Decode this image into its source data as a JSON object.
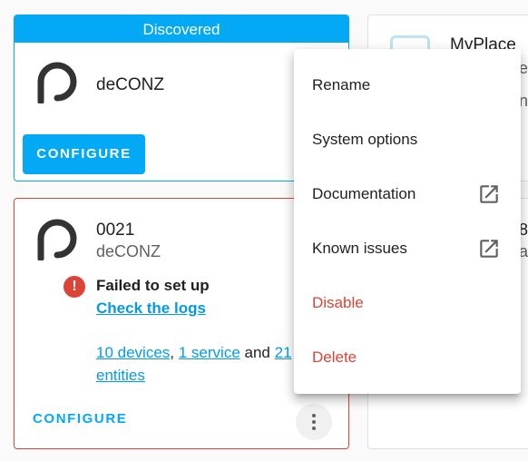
{
  "discovered_card": {
    "header": "Discovered",
    "title": "deCONZ",
    "configure_label": "CONFIGURE"
  },
  "failed_card": {
    "title": "0021",
    "subtitle": "deCONZ",
    "error_text": "Failed to set up",
    "logs_link": "Check the logs",
    "devices_link": "10 devices",
    "comma": ",",
    "service_link": "1 service",
    "and_text": "and",
    "entities_count_link": "21",
    "entities_link": "entities",
    "configure_label": "CONFIGURE"
  },
  "right_top_card": {
    "title": "MyPlace",
    "clipped_1": "e",
    "clipped_2": "n"
  },
  "right_bottom_card": {
    "clipped_1": "8",
    "clipped_2": "a"
  },
  "menu": {
    "items": [
      {
        "label": "Rename",
        "external": false,
        "danger": false
      },
      {
        "label": "System options",
        "external": false,
        "danger": false
      },
      {
        "label": "Documentation",
        "external": true,
        "danger": false
      },
      {
        "label": "Known issues",
        "external": true,
        "danger": false
      },
      {
        "label": "Disable",
        "external": false,
        "danger": true
      },
      {
        "label": "Delete",
        "external": false,
        "danger": true
      }
    ]
  },
  "colors": {
    "accent": "#03a9f4",
    "error": "#db4437",
    "link": "#039be5"
  },
  "icons": {
    "integration_logo": "deconz-logo-icon",
    "error": "alert-circle-icon",
    "overflow": "dots-vertical-icon",
    "external": "open-in-new-icon"
  }
}
